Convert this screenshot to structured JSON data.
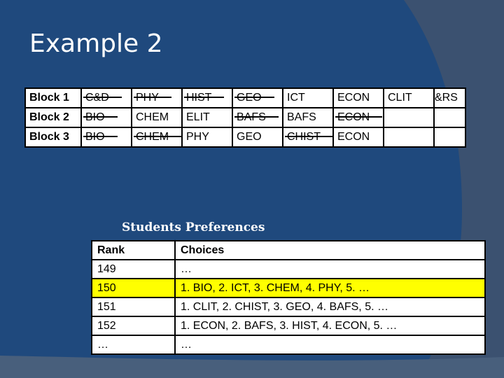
{
  "slide": {
    "title": "Example 2",
    "colors": {
      "background": "#1f497d",
      "arc": "#3b5170",
      "highlight": "#ffff00"
    }
  },
  "blocks_table": {
    "rows": [
      {
        "label": "Block 1",
        "cells": [
          {
            "text": "C&D",
            "struck": true
          },
          {
            "text": "PHY",
            "struck": true
          },
          {
            "text": "HIST",
            "struck": true
          },
          {
            "text": "GEO",
            "struck": true
          },
          {
            "text": "ICT",
            "struck": false
          },
          {
            "text": "ECON",
            "struck": false
          },
          {
            "text": "CLIT",
            "struck": false
          },
          {
            "text": "&RS",
            "struck": false
          }
        ]
      },
      {
        "label": "Block 2",
        "cells": [
          {
            "text": "BIO",
            "struck": true
          },
          {
            "text": "CHEM",
            "struck": false
          },
          {
            "text": "ELIT",
            "struck": false
          },
          {
            "text": "BAFS",
            "struck": true
          },
          {
            "text": "BAFS",
            "struck": false
          },
          {
            "text": "ECON",
            "struck": true
          },
          {
            "text": "",
            "struck": false
          },
          {
            "text": "",
            "struck": false
          }
        ]
      },
      {
        "label": "Block 3",
        "cells": [
          {
            "text": "BIO",
            "struck": true
          },
          {
            "text": "CHEM",
            "struck": true
          },
          {
            "text": "PHY",
            "struck": false
          },
          {
            "text": "GEO",
            "struck": false
          },
          {
            "text": "CHIST",
            "struck": true
          },
          {
            "text": "ECON",
            "struck": false
          },
          {
            "text": "",
            "struck": false
          },
          {
            "text": "",
            "struck": false
          }
        ]
      }
    ]
  },
  "preferences": {
    "title": "Students Preferences",
    "headers": [
      "Rank",
      "Choices"
    ],
    "rows": [
      {
        "rank": "149",
        "choices": "…",
        "highlighted": false
      },
      {
        "rank": "150",
        "choices": "1. BIO, 2. ICT, 3. CHEM, 4. PHY, 5. …",
        "highlighted": true
      },
      {
        "rank": "151",
        "choices": "1. CLIT, 2. CHIST, 3. GEO, 4. BAFS, 5. …",
        "highlighted": false
      },
      {
        "rank": "152",
        "choices": "1. ECON, 2. BAFS, 3. HIST, 4. ECON, 5. …",
        "highlighted": false
      },
      {
        "rank": "…",
        "choices": "…",
        "highlighted": false
      }
    ]
  }
}
